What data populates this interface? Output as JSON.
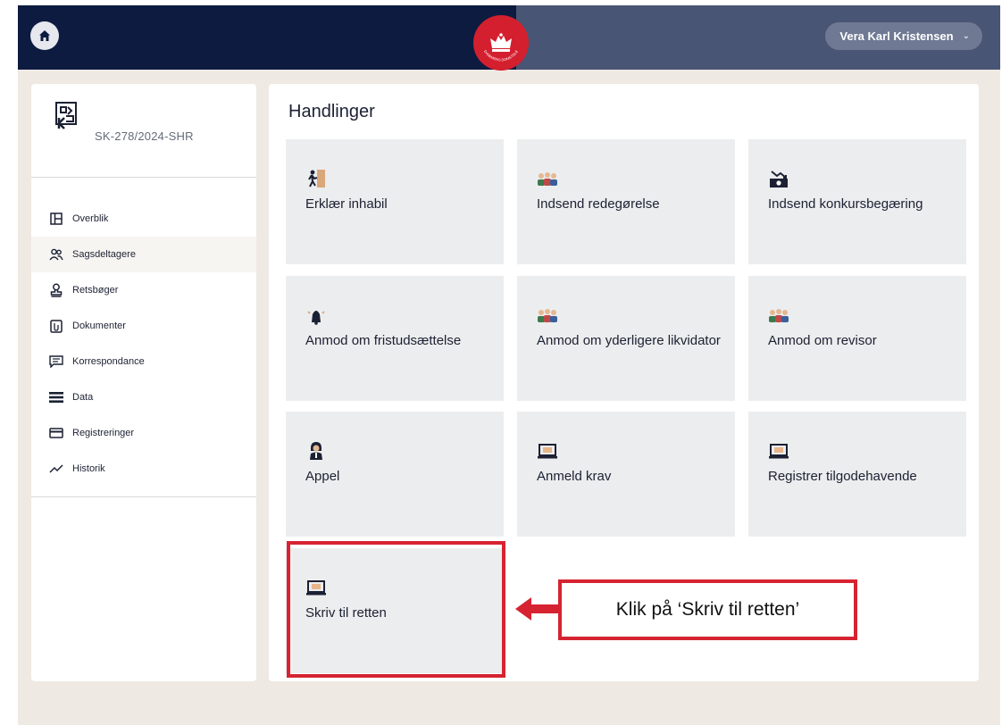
{
  "header": {
    "home_icon": "home-icon",
    "crest_text": "DANMARKS DOMSTOLE",
    "user_name": "Vera Karl Kristensen",
    "user_chevron": "⌄",
    "colors": {
      "left": "#0d1b40",
      "right": "#495574",
      "crest": "#d41f2e"
    }
  },
  "sidebar": {
    "case_id": "SK-278/2024-SHR",
    "items": [
      {
        "label": "Overblik",
        "icon": "layout-icon"
      },
      {
        "label": "Sagsdeltagere",
        "icon": "people-icon"
      },
      {
        "label": "Retsbøger",
        "icon": "stamp-icon"
      },
      {
        "label": "Dokumenter",
        "icon": "document-icon"
      },
      {
        "label": "Korrespondance",
        "icon": "message-icon"
      },
      {
        "label": "Data",
        "icon": "list-icon"
      },
      {
        "label": "Registreringer",
        "icon": "card-icon"
      },
      {
        "label": "Historik",
        "icon": "trend-icon"
      }
    ]
  },
  "main": {
    "title": "Handlinger",
    "tiles": [
      {
        "label": "Erklær inhabil",
        "icon": "exit-person-icon"
      },
      {
        "label": "Indsend redegørelse",
        "icon": "group-icon"
      },
      {
        "label": "Indsend konkursbegæring",
        "icon": "register-icon"
      },
      {
        "label": "Anmod om fristudsættelse",
        "icon": "bell-icon"
      },
      {
        "label": "Anmod om yderligere likvidator",
        "icon": "group-icon"
      },
      {
        "label": "Anmod om revisor",
        "icon": "group-icon"
      },
      {
        "label": "Appel",
        "icon": "judge-icon"
      },
      {
        "label": "Anmeld krav",
        "icon": "laptop-icon"
      },
      {
        "label": "Registrer tilgodehavende",
        "icon": "laptop-icon"
      },
      {
        "label": "Skriv til retten",
        "icon": "laptop-icon"
      }
    ]
  },
  "annotation": {
    "callout_text": "Klik på ‘Skriv til retten’",
    "color": "#d62331"
  }
}
